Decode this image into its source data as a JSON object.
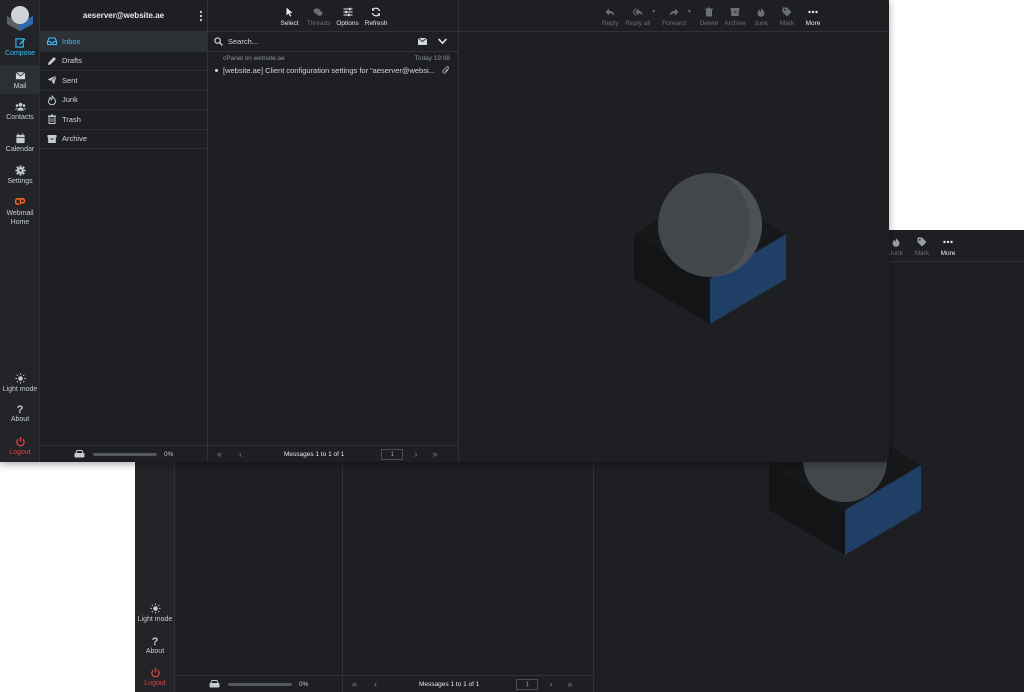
{
  "account": {
    "email": "aeserver@website.ae"
  },
  "rail": {
    "compose": "Compose",
    "mail": "Mail",
    "contacts": "Contacts",
    "calendar": "Calendar",
    "settings": "Settings",
    "webmail_home": "Webmail Home",
    "light_mode": "Light mode",
    "about": "About",
    "logout": "Logout"
  },
  "folders": [
    "Inbox",
    "Drafts",
    "Sent",
    "Junk",
    "Trash",
    "Archive"
  ],
  "quota": {
    "percent_label": "0%",
    "used_fraction": 0
  },
  "list_toolbar": {
    "select": "Select",
    "threads": "Threads",
    "options": "Options",
    "refresh": "Refresh"
  },
  "search": {
    "placeholder": "Search..."
  },
  "messages": [
    {
      "from": "cPanel on website.ae",
      "date": "Today 19:08",
      "subject": "[website.ae] Client configuration settings for “aeserver@websi..."
    }
  ],
  "pager": {
    "status": "Messages 1 to 1 of 1",
    "page": "1"
  },
  "message_toolbar": {
    "reply": "Reply",
    "reply_all": "Reply all",
    "forward": "Forward",
    "delete": "Delete",
    "archive": "Archive",
    "junk": "Junk",
    "mark": "Mark",
    "more": "More"
  },
  "colors": {
    "accent": "#37beff",
    "logout": "#e04343",
    "background": "#1d1f22",
    "logo_blue": "#1f3f66"
  }
}
